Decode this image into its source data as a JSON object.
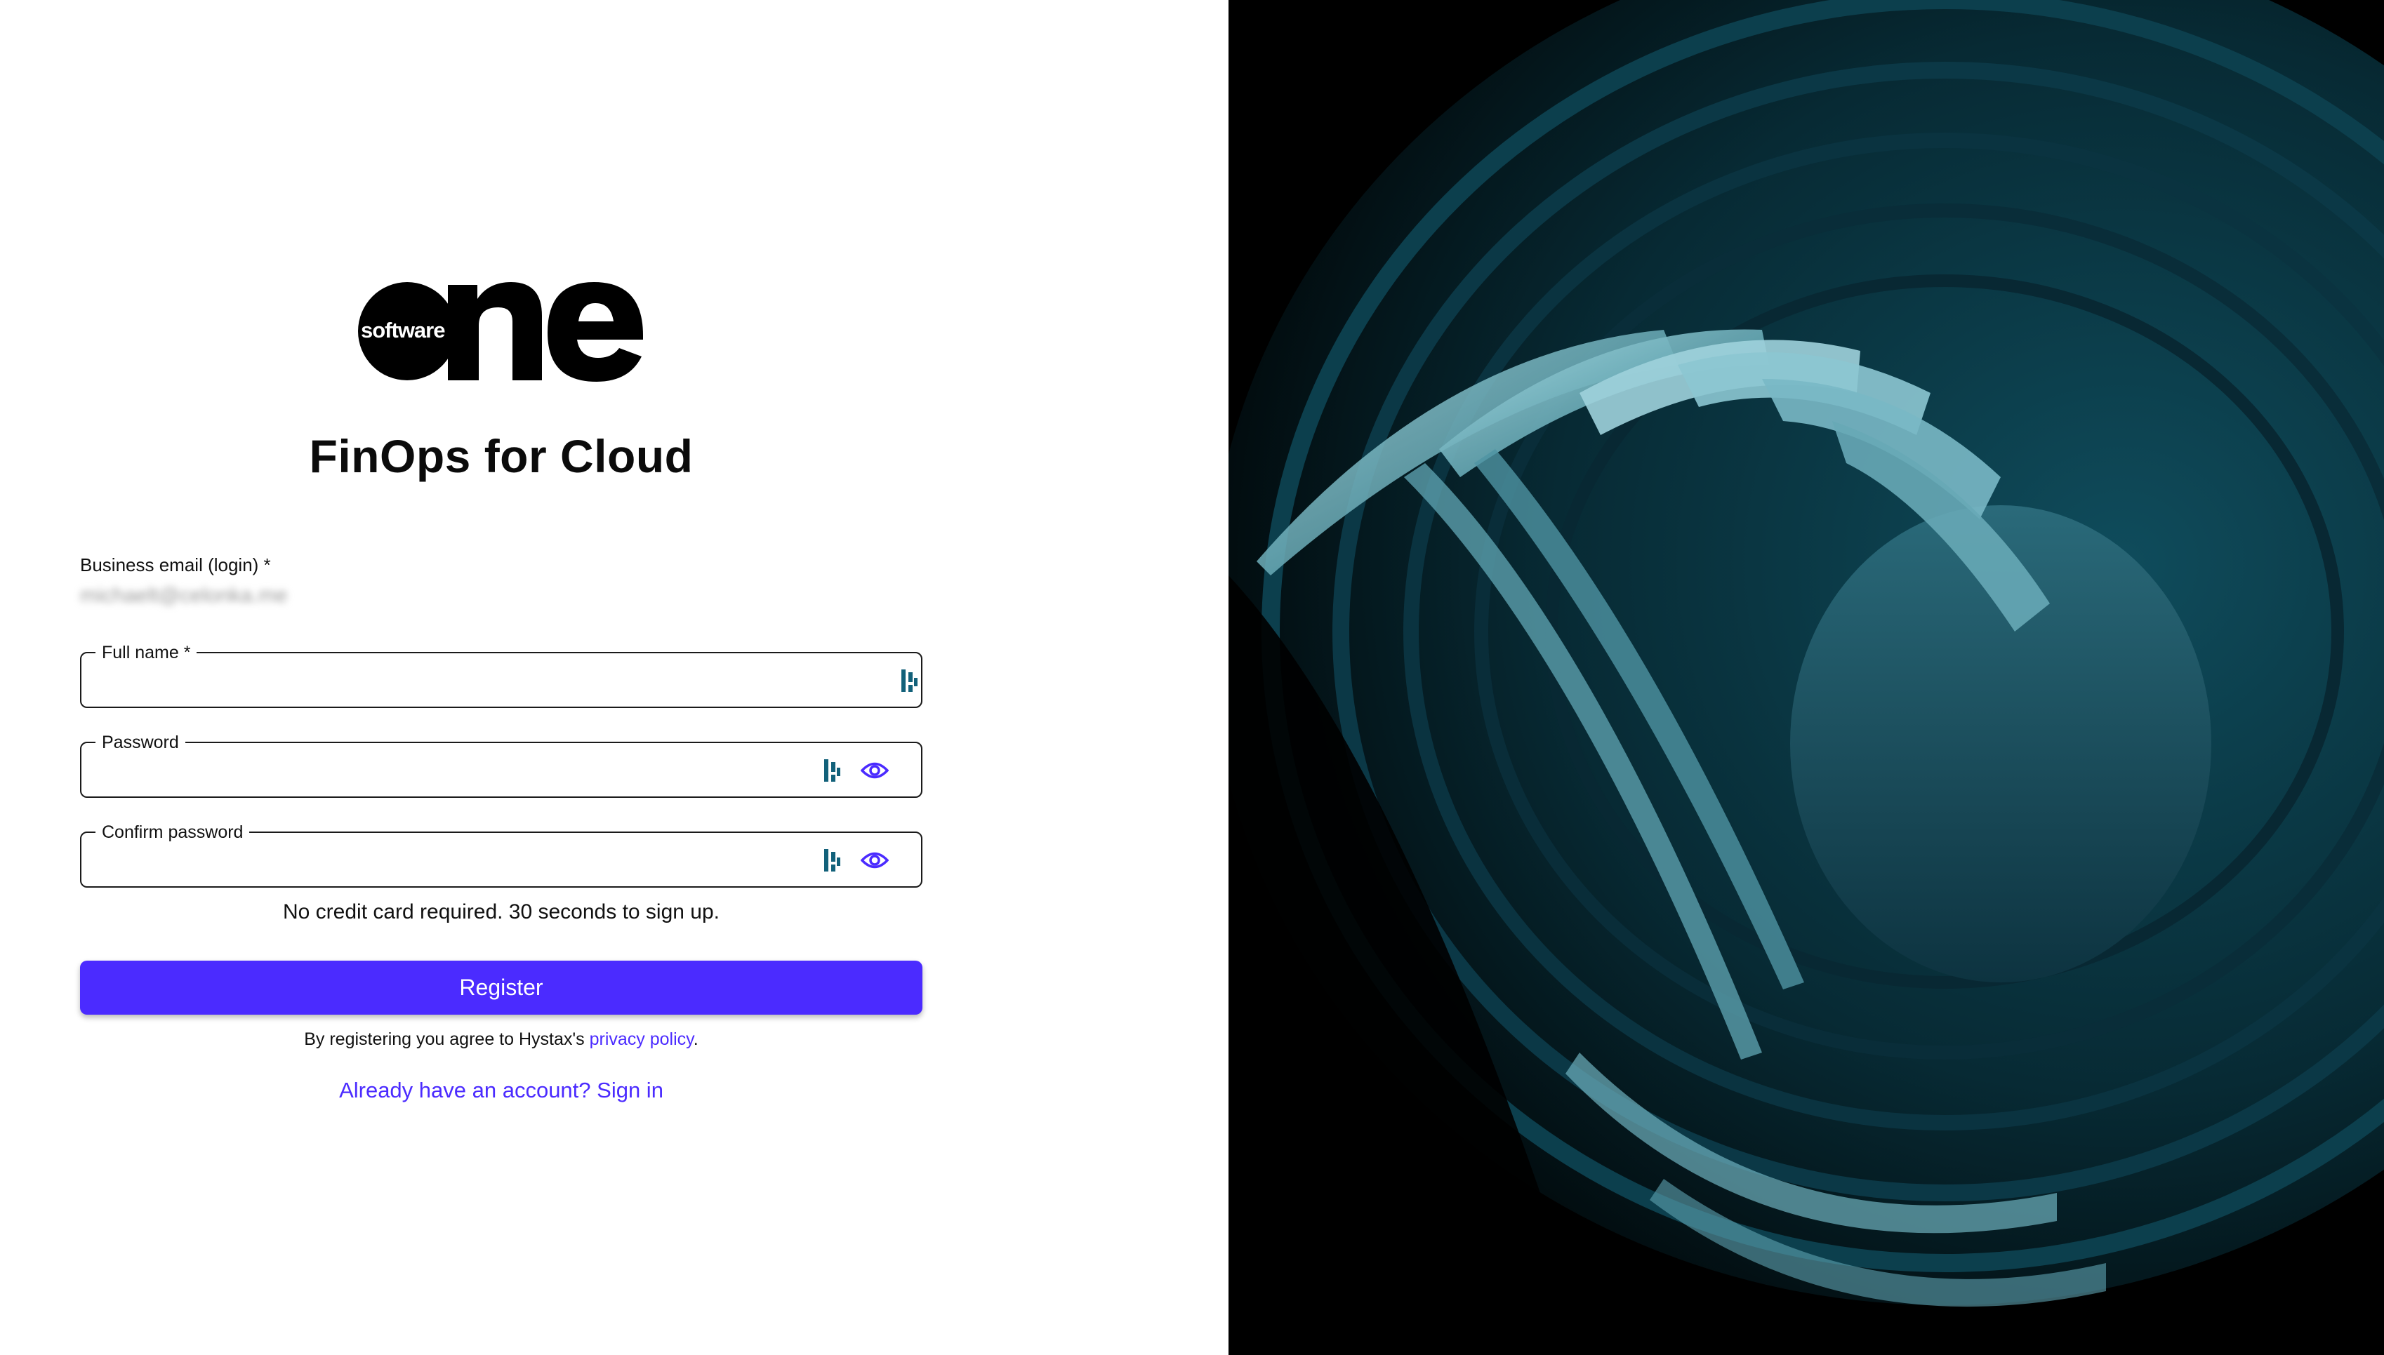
{
  "brand": {
    "logo_small_text": "software",
    "logo_big_text": "ne"
  },
  "app_title": "FinOps for Cloud",
  "email": {
    "label": "Business email (login)",
    "required_mark": " *",
    "value": "michaelt@celonka.me"
  },
  "fields": {
    "full_name": {
      "label": "Full name",
      "required_mark": " *",
      "value": ""
    },
    "password": {
      "label": "Password",
      "value": ""
    },
    "confirm_password": {
      "label": "Confirm password",
      "value": ""
    }
  },
  "hint": "No credit card required. 30 seconds to sign up.",
  "register_label": "Register",
  "agreement": {
    "prefix": "By registering you agree to Hystax's ",
    "link": "privacy policy",
    "suffix": "."
  },
  "signin_link": "Already have an account? Sign in",
  "colors": {
    "accent": "#4b2bff",
    "bitwarden_icon": "#175ddc",
    "background_art": "#0b3a48"
  },
  "icons": [
    "bitwarden-icon",
    "eye-icon"
  ]
}
